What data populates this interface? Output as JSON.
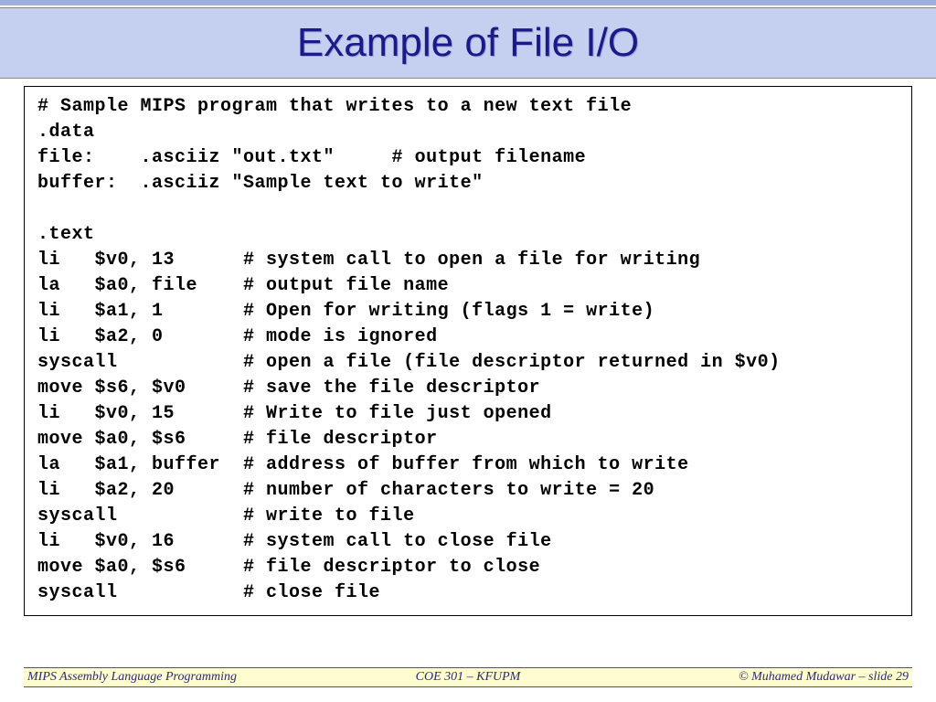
{
  "title": "Example of File I/O",
  "code": [
    "# Sample MIPS program that writes to a new text file",
    ".data",
    "file:    .asciiz \"out.txt\"     # output filename",
    "buffer:  .asciiz \"Sample text to write\"",
    "",
    ".text",
    "li   $v0, 13      # system call to open a file for writing",
    "la   $a0, file    # output file name",
    "li   $a1, 1       # Open for writing (flags 1 = write)",
    "li   $a2, 0       # mode is ignored",
    "syscall           # open a file (file descriptor returned in $v0)",
    "move $s6, $v0     # save the file descriptor",
    "li   $v0, 15      # Write to file just opened",
    "move $a0, $s6     # file descriptor",
    "la   $a1, buffer  # address of buffer from which to write",
    "li   $a2, 20      # number of characters to write = 20",
    "syscall           # write to file",
    "li   $v0, 16      # system call to close file",
    "move $a0, $s6     # file descriptor to close",
    "syscall           # close file"
  ],
  "footer": {
    "left": "MIPS Assembly Language Programming",
    "center": "COE 301 – KFUPM",
    "right": "© Muhamed Mudawar – slide 29"
  }
}
